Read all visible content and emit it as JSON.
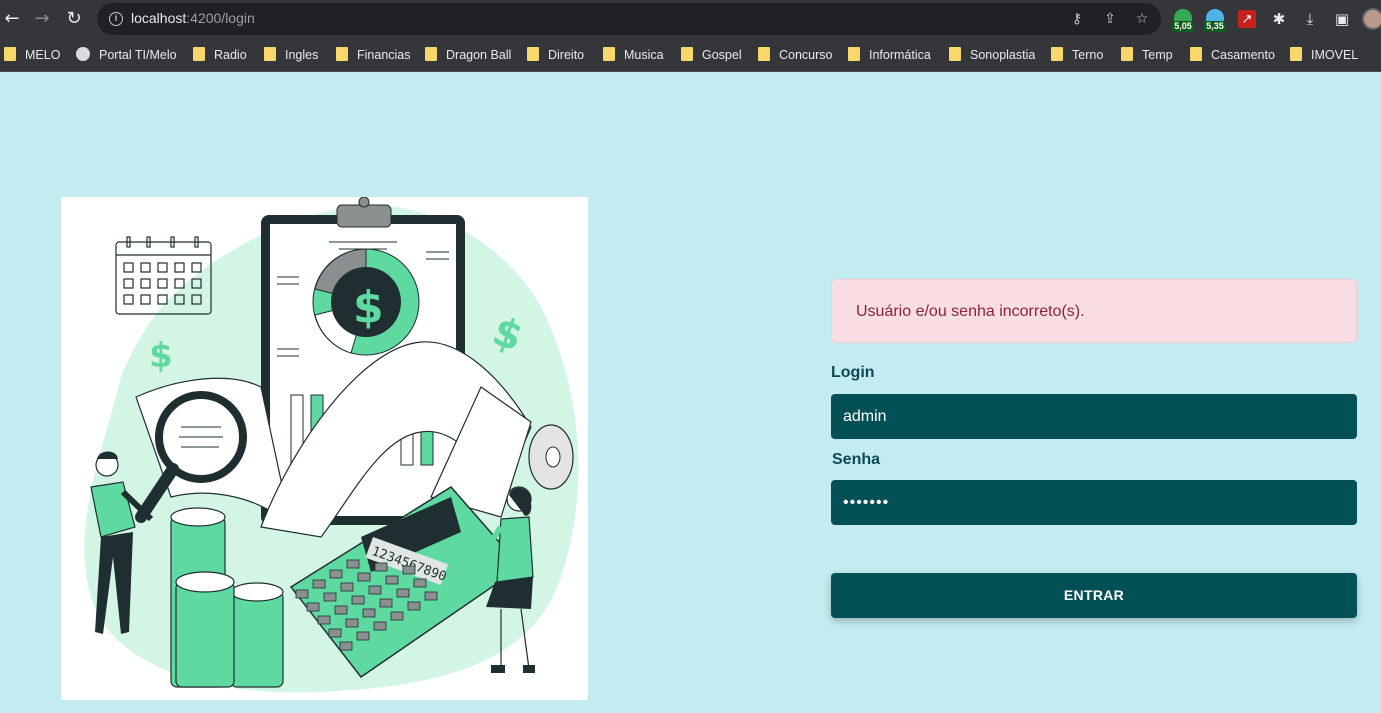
{
  "browser": {
    "url_host": "localhost",
    "url_path": ":4200/login",
    "extensions": [
      {
        "name": "extension-green-badge",
        "badge": "5,05",
        "color": "#34a853"
      },
      {
        "name": "extension-blue-badge",
        "badge": "5,35",
        "color": "#4db3e6"
      }
    ]
  },
  "bookmarks": [
    {
      "label": "MELO",
      "icon": "folder-icon"
    },
    {
      "label": "Portal TI/Melo",
      "icon": "globe-icon"
    },
    {
      "label": "Radio",
      "icon": "folder-icon"
    },
    {
      "label": "Ingles",
      "icon": "folder-icon"
    },
    {
      "label": "Financias",
      "icon": "folder-icon"
    },
    {
      "label": "Dragon Ball",
      "icon": "folder-icon"
    },
    {
      "label": "Direito",
      "icon": "folder-icon"
    },
    {
      "label": "Musica",
      "icon": "folder-icon"
    },
    {
      "label": "Gospel",
      "icon": "folder-icon"
    },
    {
      "label": "Concurso",
      "icon": "folder-icon"
    },
    {
      "label": "Informática",
      "icon": "folder-icon"
    },
    {
      "label": "Sonoplastia",
      "icon": "folder-icon"
    },
    {
      "label": "Terno",
      "icon": "folder-icon"
    },
    {
      "label": "Temp",
      "icon": "folder-icon"
    },
    {
      "label": "Casamento",
      "icon": "folder-icon"
    },
    {
      "label": "IMOVEL",
      "icon": "folder-icon"
    }
  ],
  "illustration": {
    "calculator_display": "1234567890",
    "accent": "#5edaa1",
    "dark": "#1f2e30"
  },
  "login": {
    "error_message": "Usuário e/ou senha incorreto(s).",
    "login_label": "Login",
    "login_value": "admin",
    "password_label": "Senha",
    "password_value": "•••••••",
    "submit_label": "ENTRAR"
  },
  "colors": {
    "background": "#c4ecf0",
    "field": "#035057",
    "alert_bg": "#f8dde3",
    "alert_text": "#8a2338"
  }
}
